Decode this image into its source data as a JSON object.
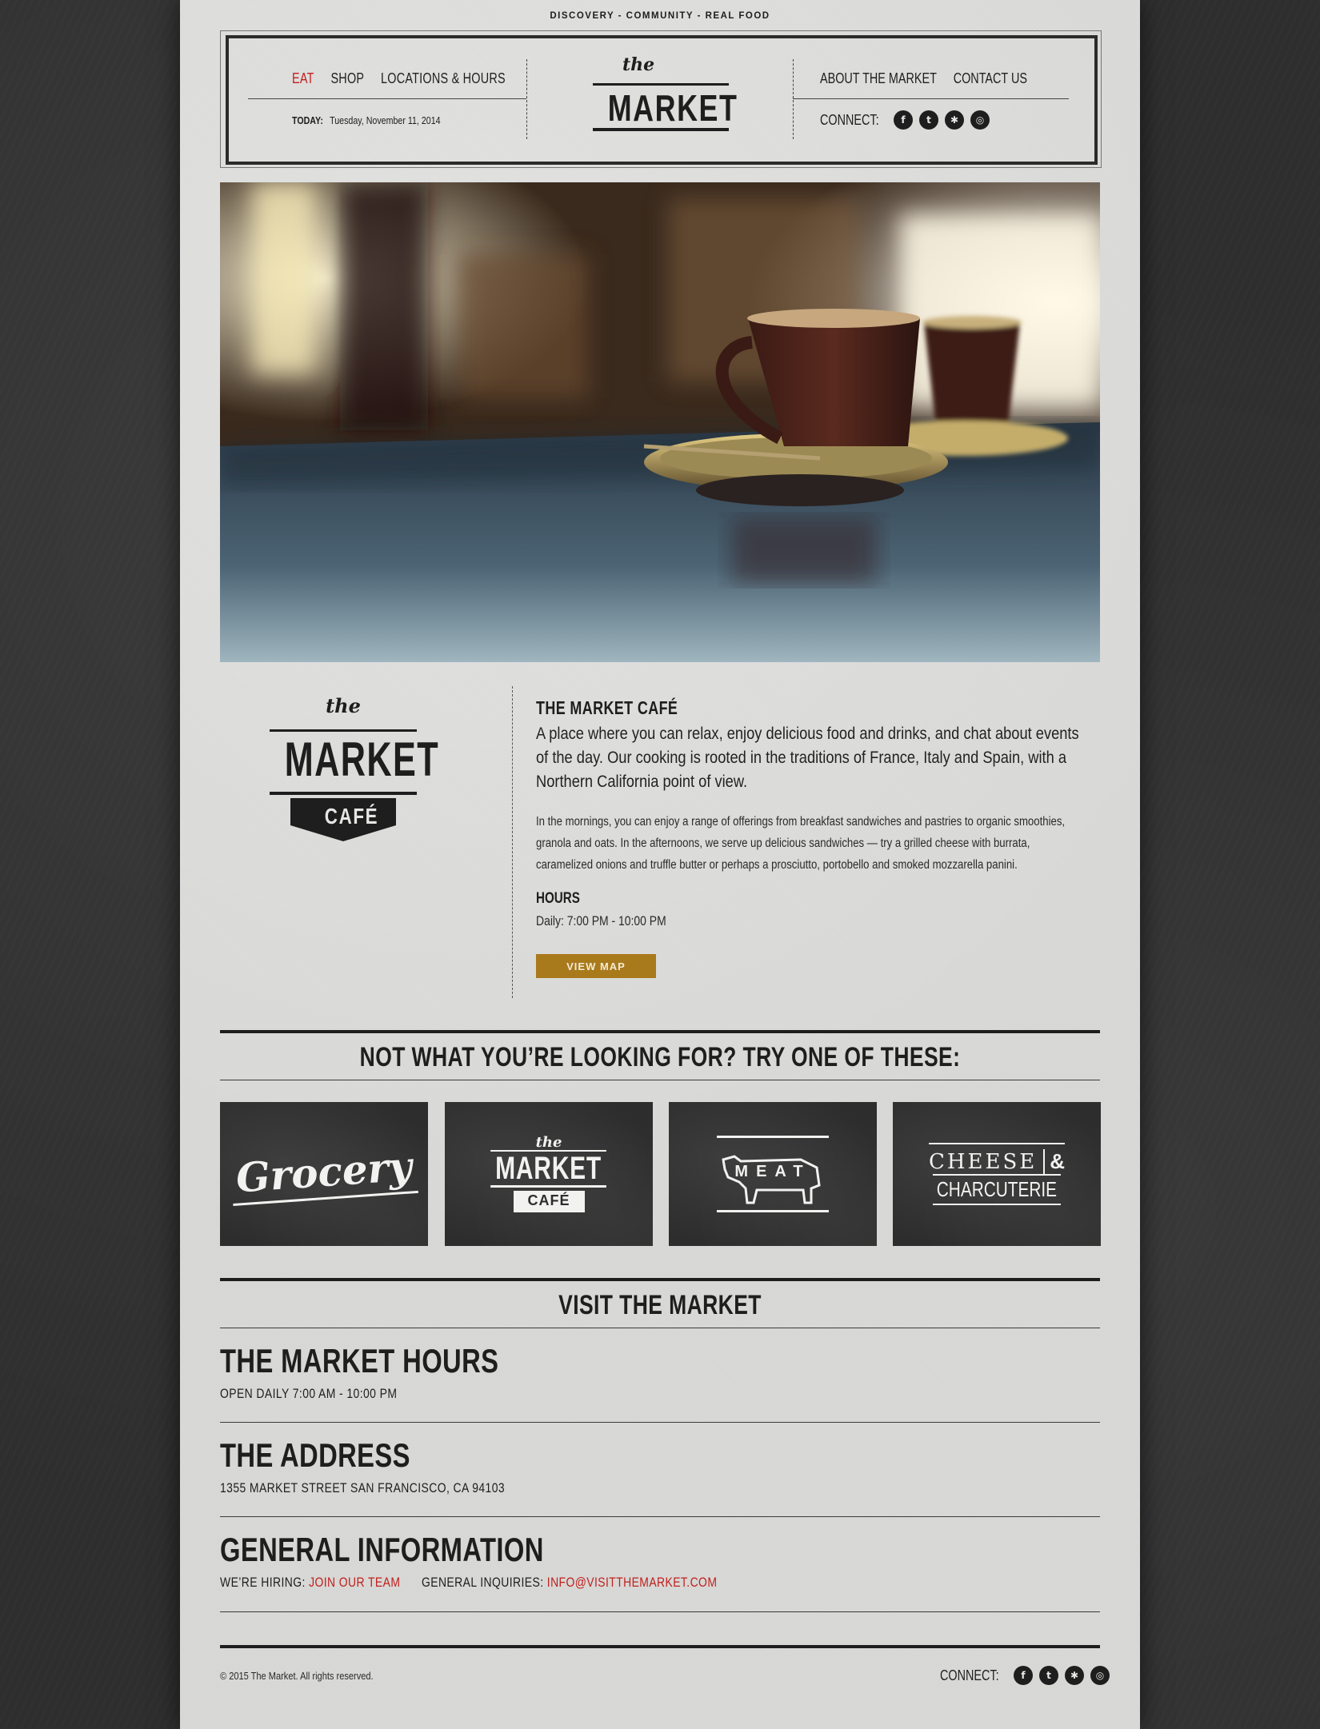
{
  "tagline": "DISCOVERY - COMMUNITY - REAL FOOD",
  "header": {
    "nav_left": [
      "EAT",
      "SHOP",
      "LOCATIONS & HOURS"
    ],
    "nav_right": [
      "ABOUT THE MARKET",
      "CONTACT US"
    ],
    "today_label": "TODAY:",
    "today_value": "Tuesday, November 11, 2014",
    "logo_the": "the",
    "logo_market": "MARKET",
    "connect_label": "CONNECT:"
  },
  "social_icons": [
    {
      "name": "facebook-icon",
      "glyph": "f"
    },
    {
      "name": "twitter-icon",
      "glyph": "t"
    },
    {
      "name": "yelp-icon",
      "glyph": "✱"
    },
    {
      "name": "instagram-icon",
      "glyph": "◎"
    }
  ],
  "cafe": {
    "logo_the": "the",
    "logo_market": "MARKET",
    "logo_cafe": "CAFÉ",
    "title": "THE MARKET CAFÉ",
    "lead": "A place where you can relax, enjoy delicious food and drinks, and chat about events of the day. Our cooking is rooted in the traditions of France, Italy and Spain, with a Northern California point of view.",
    "body": "In the mornings, you can enjoy a range of offerings from breakfast sandwiches and pastries to organic smoothies, granola and oats. In the afternoons, we serve up delicious sandwiches — try a grilled cheese with burrata, caramelized onions and truffle butter or perhaps a prosciutto, portobello and smoked mozzarella panini.",
    "hours_title": "HOURS",
    "hours_text": "Daily: 7:00 PM - 10:00 PM",
    "view_map": "VIEW MAP"
  },
  "suggest": {
    "heading": "NOT WHAT YOU’RE LOOKING FOR? TRY ONE OF THESE:",
    "tiles": [
      {
        "label": "Grocery"
      },
      {
        "the": "the",
        "market": "MARKET",
        "cafe": "CAFÉ"
      },
      {
        "label": "MEAT"
      },
      {
        "line1": "CHEESE",
        "amp": "&",
        "line2": "CHARCUTERIE"
      }
    ]
  },
  "visit": {
    "heading": "VISIT THE MARKET",
    "hours_title": "THE MARKET HOURS",
    "hours_text": "OPEN DAILY 7:00 AM - 10:00 PM",
    "address_title": "THE ADDRESS",
    "address_text": "1355 MARKET STREET SAN FRANCISCO, CA 94103",
    "general_title": "GENERAL INFORMATION",
    "hiring_label": "WE’RE HIRING:",
    "hiring_link": "JOIN OUR TEAM",
    "inquiries_label": "GENERAL INQUIRIES:",
    "inquiries_link": "INFO@VISITTHEMARKET.COM"
  },
  "footer": {
    "copyright": "© 2015 The Market. All rights reserved.",
    "connect_label": "CONNECT:"
  },
  "colors": {
    "accent_red": "#c0201d",
    "button_gold": "#a97a1c",
    "paper": "#d8d8d6",
    "chalkboard": "#2e2e2e"
  }
}
